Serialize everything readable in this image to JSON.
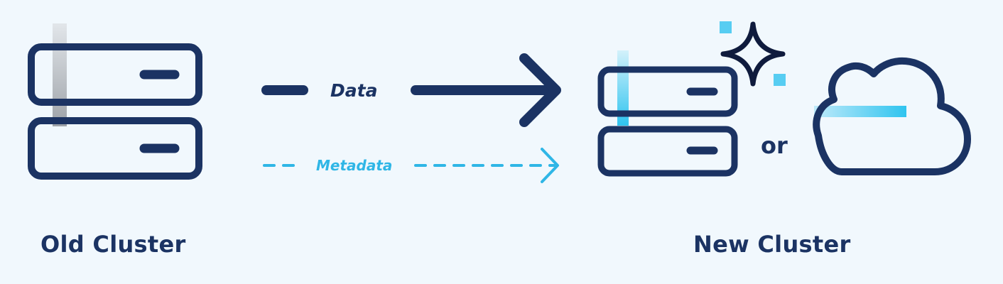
{
  "diagram": {
    "old_cluster_label": "Old Cluster",
    "new_cluster_label": "New Cluster",
    "data_label": "Data",
    "metadata_label": "Metadata",
    "or_label": "or"
  },
  "colors": {
    "background": "#f1f8fd",
    "navy": "#1b3363",
    "cyan": "#2fb6e6",
    "sparkle": "#0f1b3d"
  },
  "icons": [
    "server-icon",
    "arrow-right-icon",
    "sparkle-icon",
    "cloud-icon"
  ]
}
